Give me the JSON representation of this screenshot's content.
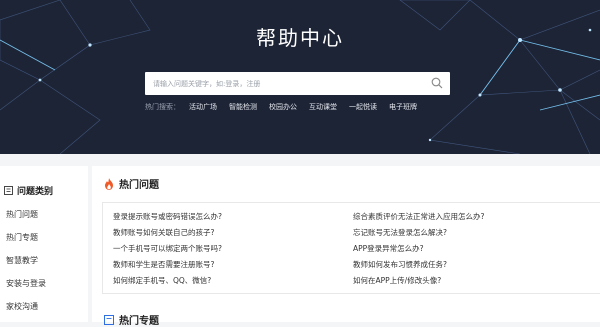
{
  "hero": {
    "title": "帮助中心",
    "search_placeholder": "请输入问题关键字，如:登录，注册",
    "hot_label": "热门搜索：",
    "hot_keywords": [
      "活动广场",
      "智能检测",
      "校园办公",
      "互动课堂",
      "一起悦读",
      "电子班牌"
    ]
  },
  "sidebar": {
    "title": "问题类别",
    "items": [
      "热门问题",
      "热门专题",
      "智慧教学",
      "安装与登录",
      "家校沟通"
    ]
  },
  "hot_questions": {
    "title": "热门问题",
    "left": [
      "登录提示账号或密码错误怎么办?",
      "教师账号如何关联自己的孩子?",
      "一个手机号可以绑定两个账号吗?",
      "教师和学生是否需要注册账号?",
      "如何绑定手机号、QQ、微信?"
    ],
    "right": [
      "综合素质评价无法正常进入应用怎么办?",
      "忘记账号无法登录怎么解决?",
      "APP登录异常怎么办?",
      "教师如何发布习惯养成任务?",
      "如何在APP上传/修改头像?"
    ]
  },
  "hot_topics": {
    "title": "热门专题"
  },
  "colors": {
    "hero_bg": "#1d2436",
    "fire": "#f05a28",
    "accent": "#2f6fe4"
  }
}
